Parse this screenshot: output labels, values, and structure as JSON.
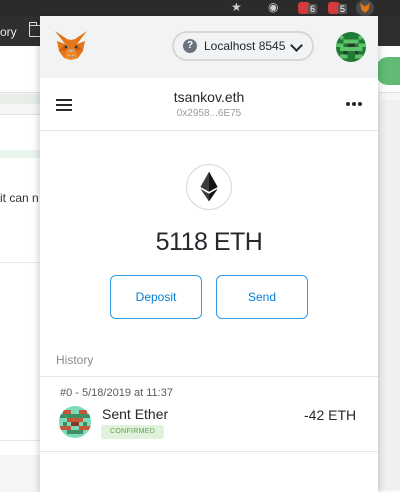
{
  "browser": {
    "bookmark_text": "ory",
    "ext_badge_counts": [
      "6",
      "5"
    ]
  },
  "page": {
    "partial_text": "it can n"
  },
  "popup": {
    "network": {
      "label": "Localhost 8545",
      "help_glyph": "?"
    },
    "account": {
      "name": "tsankov.eth",
      "address": "0x2958...6E75"
    },
    "balance": "5118 ETH",
    "actions": {
      "deposit_label": "Deposit",
      "send_label": "Send"
    },
    "history": {
      "title": "History",
      "transactions": [
        {
          "date": "#0 - 5/18/2019 at 11:37",
          "action": "Sent Ether",
          "status": "CONFIRMED",
          "amount": "-42 ETH"
        }
      ]
    }
  },
  "colors": {
    "accent_blue": "#037dd6",
    "confirmed_text": "#5f9e4c",
    "confirmed_bg": "#e0f2dc",
    "fox_orange": "#e2761b"
  },
  "icons": [
    "folder-icon",
    "star-icon",
    "extension-icon",
    "metamask-fox-icon",
    "help-icon",
    "chevron-down-icon",
    "avatar-identicon",
    "hamburger-menu-icon",
    "more-options-icon",
    "ethereum-logo-icon",
    "transaction-identicon"
  ]
}
